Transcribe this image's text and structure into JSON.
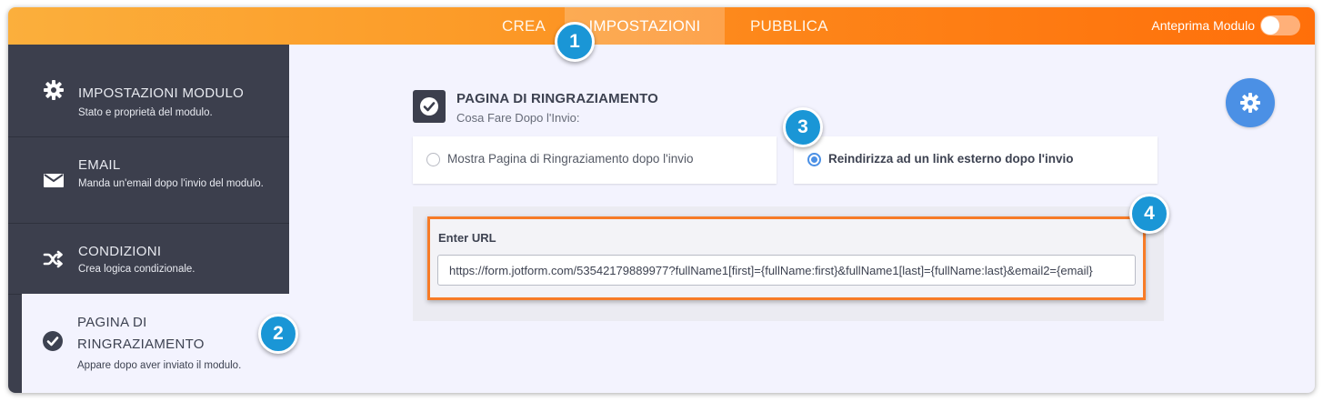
{
  "header": {
    "tabs": [
      {
        "label": "CREA"
      },
      {
        "label": "IMPOSTAZIONI"
      },
      {
        "label": "PUBBLICA"
      }
    ],
    "active_tab": "IMPOSTAZIONI",
    "preview_label": "Anteprima Modulo"
  },
  "sidebar": {
    "items": [
      {
        "title": "IMPOSTAZIONI MODULO",
        "desc": "Stato e proprietà del modulo.",
        "icon": "gear-icon"
      },
      {
        "title": "EMAIL",
        "desc": "Manda un'email dopo l'invio del modulo.",
        "icon": "envelope-icon"
      },
      {
        "title": "CONDIZIONI",
        "desc": "Crea logica condizionale.",
        "icon": "shuffle-icon"
      },
      {
        "title": "PAGINA DI RINGRAZIAMENTO",
        "desc": "Appare dopo aver inviato il modulo.",
        "icon": "check-circle-icon"
      }
    ]
  },
  "main": {
    "title": "PAGINA DI RINGRAZIAMENTO",
    "subtitle": "Cosa Fare Dopo l'Invio:",
    "options": [
      {
        "label": "Mostra Pagina di Ringraziamento dopo l'invio",
        "selected": false
      },
      {
        "label": "Reindirizza ad un link esterno dopo l'invio",
        "selected": true
      }
    ],
    "url_label": "Enter URL",
    "url_value": "https://form.jotform.com/53542179889977?fullName1[first]={fullName:first}&fullName1[last]={fullName:last}&email2={email}"
  },
  "badges": [
    "1",
    "2",
    "3",
    "4"
  ],
  "colors": {
    "accent_orange": "#fd8519",
    "sidebar_bg": "#3c3f4d",
    "accent_blue": "#4b90e5",
    "badge_blue": "#1a96d6",
    "highlight_border": "#f77b27"
  }
}
